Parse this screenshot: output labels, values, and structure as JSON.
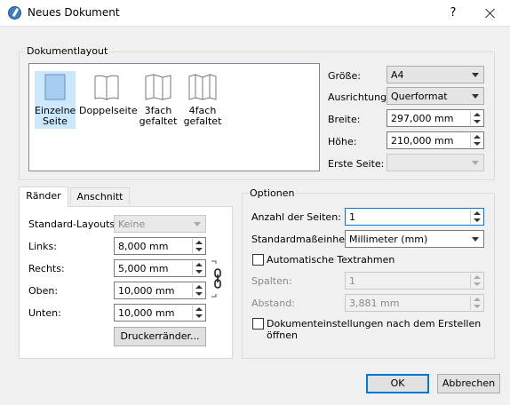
{
  "window": {
    "title": "Neues Dokument",
    "help": "?"
  },
  "layout": {
    "group_title": "Dokumentlayout",
    "options": [
      {
        "line1": "Einzelne",
        "line2": "Seite",
        "selected": true
      },
      {
        "line1": "Doppelseite",
        "line2": "",
        "selected": false
      },
      {
        "line1": "3fach",
        "line2": "gefaltet",
        "selected": false
      },
      {
        "line1": "4fach",
        "line2": "gefaltet",
        "selected": false
      }
    ],
    "size_label": "Größe:",
    "size_value": "A4",
    "orientation_label": "Ausrichtung:",
    "orientation_value": "Querformat",
    "width_label": "Breite:",
    "width_value": "297,000 mm",
    "height_label": "Höhe:",
    "height_value": "210,000 mm",
    "first_page_label": "Erste Seite:",
    "first_page_value": ""
  },
  "tabs": [
    {
      "label": "Ränder"
    },
    {
      "label": "Anschnitt"
    }
  ],
  "margins": {
    "standard_label": "Standard-Layouts:",
    "standard_value": "Keine",
    "left_label": "Links:",
    "left_value": "8,000 mm",
    "right_label": "Rechts:",
    "right_value": "5,000 mm",
    "top_label": "Oben:",
    "top_value": "10,000 mm",
    "bottom_label": "Unten:",
    "bottom_value": "10,000 mm",
    "printer_margins_button": "Druckerränder..."
  },
  "options": {
    "group_title": "Optionen",
    "pages_label": "Anzahl der Seiten:",
    "pages_value": "1",
    "unit_label": "Standardmaßeinheit:",
    "unit_value": "Millimeter (mm)",
    "auto_text_frames": "Automatische Textrahmen",
    "columns_label": "Spalten:",
    "columns_value": "1",
    "gap_label": "Abstand:",
    "gap_value": "3,881 mm",
    "open_settings": "Dokumenteinstellungen nach dem Erstellen öffnen"
  },
  "buttons": {
    "ok": "OK",
    "cancel": "Abbrechen"
  }
}
